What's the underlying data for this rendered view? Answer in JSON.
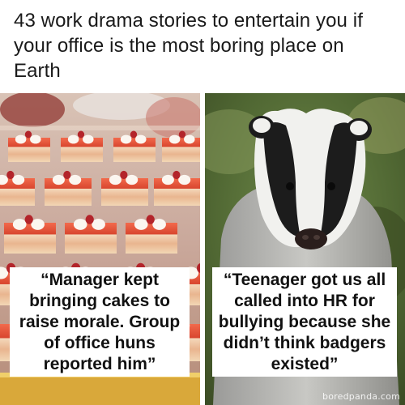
{
  "headline": "43 work drama stories to entertain you if your office is the most boring place on Earth",
  "panels": {
    "left": {
      "image": "petit-fours-cakes-photo",
      "caption": "“Manager kept bringing cakes to raise morale. Group of office huns reported him”"
    },
    "right": {
      "image": "badger-photo",
      "caption": "“Teenager got us all called into HR for bullying because she didn’t think badgers existed”"
    }
  },
  "watermark": "boredpanda.com",
  "colors": {
    "cake_red": "#e8503a",
    "cake_sponge": "#f3d3b0",
    "badger_black": "#1c1c1c",
    "badger_white": "#f2f2f0",
    "forest_green": "#55703a"
  }
}
